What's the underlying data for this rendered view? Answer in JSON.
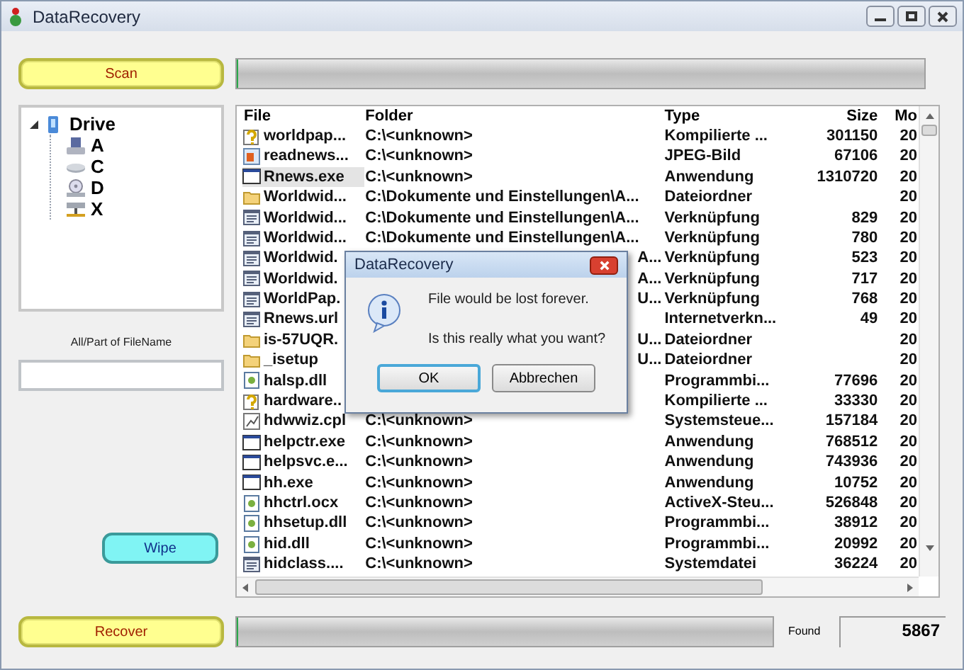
{
  "window": {
    "title": "DataRecovery"
  },
  "scan_button": {
    "label": "Scan"
  },
  "scan_progress": {
    "level": 0.003
  },
  "drive_tree": [
    {
      "label": "Drive",
      "kind": "computer",
      "expanded": true,
      "children": [
        {
          "label": "A",
          "kind": "floppy"
        },
        {
          "label": "C",
          "kind": "disk"
        },
        {
          "label": "D",
          "kind": "cdrom"
        },
        {
          "label": "X",
          "kind": "network"
        }
      ]
    }
  ],
  "filename_filter": {
    "label": "All/Part of FileName"
  },
  "wipe_button": {
    "label": "Wipe"
  },
  "recover_button": {
    "label": "Recover"
  },
  "recover_progress": {
    "level": 0.003
  },
  "found": {
    "label": "Found",
    "value": "5867"
  },
  "table": {
    "columns": [
      "File",
      "Folder",
      "Type",
      "Size",
      "Mo"
    ],
    "rows": [
      {
        "kind": "help",
        "file": "worldpap...",
        "folder": "C:\\<unknown>",
        "type": "Kompilierte ...",
        "size": "301150",
        "modified": "20",
        "selected": false
      },
      {
        "kind": "image",
        "file": "readnews...",
        "folder": "C:\\<unknown>",
        "type": "JPEG-Bild",
        "size": "67106",
        "modified": "20",
        "selected": false
      },
      {
        "kind": "app",
        "file": "Rnews.exe",
        "folder": "C:\\<unknown>",
        "type": "Anwendung",
        "size": "1310720",
        "modified": "20",
        "selected": true
      },
      {
        "kind": "folder",
        "file": "Worldwid...",
        "folder": "C:\\Dokumente und Einstellungen\\A...",
        "type": "Dateiordner",
        "size": "",
        "modified": "20",
        "selected": false
      },
      {
        "kind": "shortcut",
        "file": "Worldwid...",
        "folder": "C:\\Dokumente und Einstellungen\\A...",
        "type": "Verknüpfung",
        "size": "829",
        "modified": "20",
        "selected": false
      },
      {
        "kind": "shortcut",
        "file": "Worldwid...",
        "folder": "C:\\Dokumente und Einstellungen\\A...",
        "type": "Verknüpfung",
        "size": "780",
        "modified": "20",
        "selected": false
      },
      {
        "kind": "shortcut",
        "file": "Worldwid.",
        "folder": "A...",
        "type": "Verknüpfung",
        "size": "523",
        "modified": "20",
        "selected": false
      },
      {
        "kind": "shortcut",
        "file": "Worldwid.",
        "folder": "A...",
        "type": "Verknüpfung",
        "size": "717",
        "modified": "20",
        "selected": false
      },
      {
        "kind": "shortcut",
        "file": "WorldPap.",
        "folder": "U...",
        "type": "Verknüpfung",
        "size": "768",
        "modified": "20",
        "selected": false
      },
      {
        "kind": "shortcut",
        "file": "Rnews.url",
        "folder": "",
        "type": "Internetverkn...",
        "size": "49",
        "modified": "20",
        "selected": false
      },
      {
        "kind": "folder",
        "file": "is-57UQR.",
        "folder": "U...",
        "type": "Dateiordner",
        "size": "",
        "modified": "20",
        "selected": false
      },
      {
        "kind": "folder",
        "file": "_isetup",
        "folder": "U...",
        "type": "Dateiordner",
        "size": "",
        "modified": "20",
        "selected": false
      },
      {
        "kind": "dll",
        "file": "halsp.dll",
        "folder": "",
        "type": "Programmbi...",
        "size": "77696",
        "modified": "20",
        "selected": false
      },
      {
        "kind": "help",
        "file": "hardware..",
        "folder": "",
        "type": "Kompilierte ...",
        "size": "33330",
        "modified": "20",
        "selected": false
      },
      {
        "kind": "cpl",
        "file": "hdwwiz.cpl",
        "folder": "C:\\<unknown>",
        "type": "Systemsteue...",
        "size": "157184",
        "modified": "20",
        "selected": false
      },
      {
        "kind": "app",
        "file": "helpctr.exe",
        "folder": "C:\\<unknown>",
        "type": "Anwendung",
        "size": "768512",
        "modified": "20",
        "selected": false
      },
      {
        "kind": "app",
        "file": "helpsvc.e...",
        "folder": "C:\\<unknown>",
        "type": "Anwendung",
        "size": "743936",
        "modified": "20",
        "selected": false
      },
      {
        "kind": "app",
        "file": "hh.exe",
        "folder": "C:\\<unknown>",
        "type": "Anwendung",
        "size": "10752",
        "modified": "20",
        "selected": false
      },
      {
        "kind": "dll",
        "file": "hhctrl.ocx",
        "folder": "C:\\<unknown>",
        "type": "ActiveX-Steu...",
        "size": "526848",
        "modified": "20",
        "selected": false
      },
      {
        "kind": "dll",
        "file": "hhsetup.dll",
        "folder": "C:\\<unknown>",
        "type": "Programmbi...",
        "size": "38912",
        "modified": "20",
        "selected": false
      },
      {
        "kind": "dll",
        "file": "hid.dll",
        "folder": "C:\\<unknown>",
        "type": "Programmbi...",
        "size": "20992",
        "modified": "20",
        "selected": false
      },
      {
        "kind": "shortcut",
        "file": "hidclass....",
        "folder": "C:\\<unknown>",
        "type": "Systemdatei",
        "size": "36224",
        "modified": "20",
        "selected": false
      }
    ]
  },
  "dialog": {
    "title": "DataRecovery",
    "messages": [
      "File would be lost forever.",
      "Is this really what you want?"
    ],
    "buttons": [
      {
        "label": "OK",
        "selected": true
      },
      {
        "label": "Abbrechen",
        "selected": false
      }
    ]
  }
}
